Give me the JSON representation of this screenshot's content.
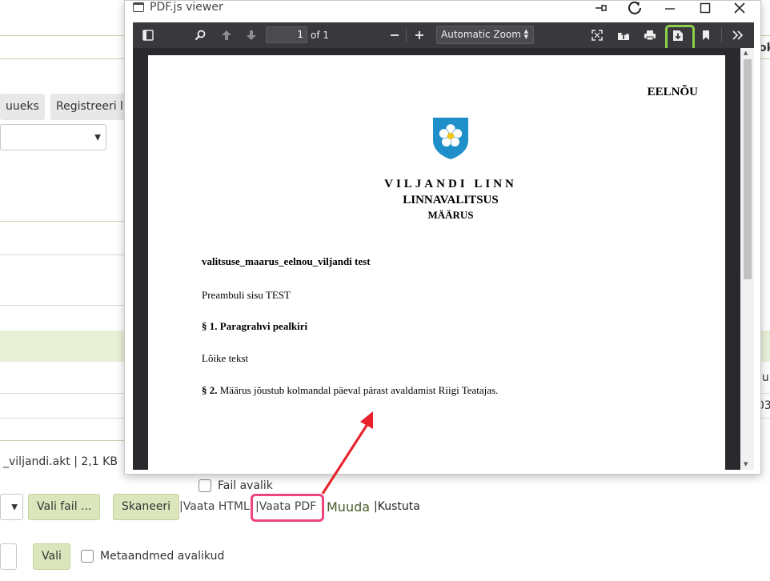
{
  "background": {
    "btn_uueks": "uueks",
    "btn_registreeri": "Registreeri l",
    "right_edge_1": "ok",
    "right_edge_2": "lu",
    "right_edge_3": "03",
    "file_info": "_viljandi.akt | 2,1 KB",
    "fail_avalik": "Fail avalik",
    "vali_fail_btn": "Vali fail ...",
    "skaneeri_btn": "Skaneeri",
    "vaata_html": "|Vaata HTML",
    "vaata_pdf": "|Vaata PDF",
    "muuda": "Muuda",
    "kustuta": "|Kustuta",
    "vali_btn": "Vali",
    "metaandmed": "Metaandmed avalikud"
  },
  "pdf_window": {
    "title": "PDF.js viewer",
    "page_number": "1",
    "page_of": "of 1",
    "zoom": "Automatic Zoom",
    "document": {
      "draft": "EELNÕU",
      "city": "VILJANDI LINN",
      "government": "LINNAVALITSUS",
      "regulation": "MÄÄRUS",
      "heading": "valitsuse_maarus_eelnou_viljandi test",
      "preamble": "Preambuli sisu TEST",
      "section1": "§ 1. Paragrahvi pealkiri",
      "paragraph": "Lõike tekst",
      "section2_num": "§ 2.",
      "section2_text": " Määrus jõustub kolmandal päeval pärast avaldamist Riigi Teatajas."
    }
  },
  "colors": {
    "toolbar_bg": "#38383d",
    "viewer_bg": "#2a2a2e",
    "download_highlight": "#8dd14b",
    "pdf_link_highlight": "#f0457a",
    "arrow": "#e8202a",
    "green_button": "#dbe6bd"
  }
}
